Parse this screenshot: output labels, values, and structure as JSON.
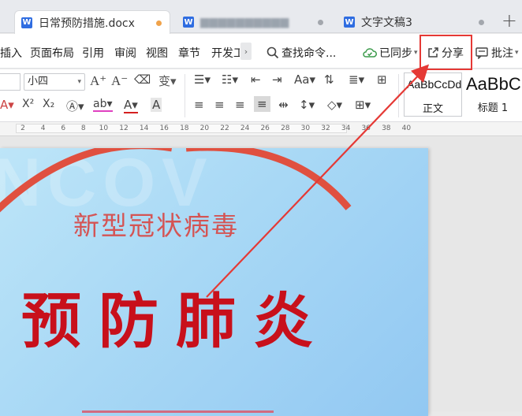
{
  "tabs": [
    {
      "label": "日常预防措施.docx",
      "icon": "W",
      "active": true
    },
    {
      "label": "▆▆▆▆▆▆▆▆▆▆",
      "icon": "W",
      "active": false
    },
    {
      "label": "文字文稿3",
      "icon": "W",
      "active": false
    }
  ],
  "menu": {
    "items": [
      "插入",
      "页面布局",
      "引用",
      "审阅",
      "视图",
      "章节",
      "开发工"
    ],
    "search": "查找命令...",
    "sync": "已同步",
    "share": "分享",
    "comment": "批注"
  },
  "ribbon": {
    "font_size": "小四",
    "styles": [
      {
        "sample": "AaBbCcDd",
        "name": "正文"
      },
      {
        "sample": "AaBbC",
        "name": "标题 1"
      }
    ]
  },
  "ruler": {
    "ticks": [
      "2",
      "4",
      "6",
      "8",
      "10",
      "12",
      "14",
      "16",
      "18",
      "20",
      "22",
      "24",
      "26",
      "28",
      "30",
      "32",
      "34",
      "36",
      "38",
      "40"
    ]
  },
  "document": {
    "watermark": "NCOV",
    "subtitle": "新型冠状病毒",
    "title": "预防肺炎"
  },
  "colors": {
    "highlight": "#e53935",
    "arrow": "#e53935",
    "title": "#c8101b",
    "subtitle": "#d45454",
    "arc": "#e05040",
    "doc_icon": "#2f6de1"
  }
}
